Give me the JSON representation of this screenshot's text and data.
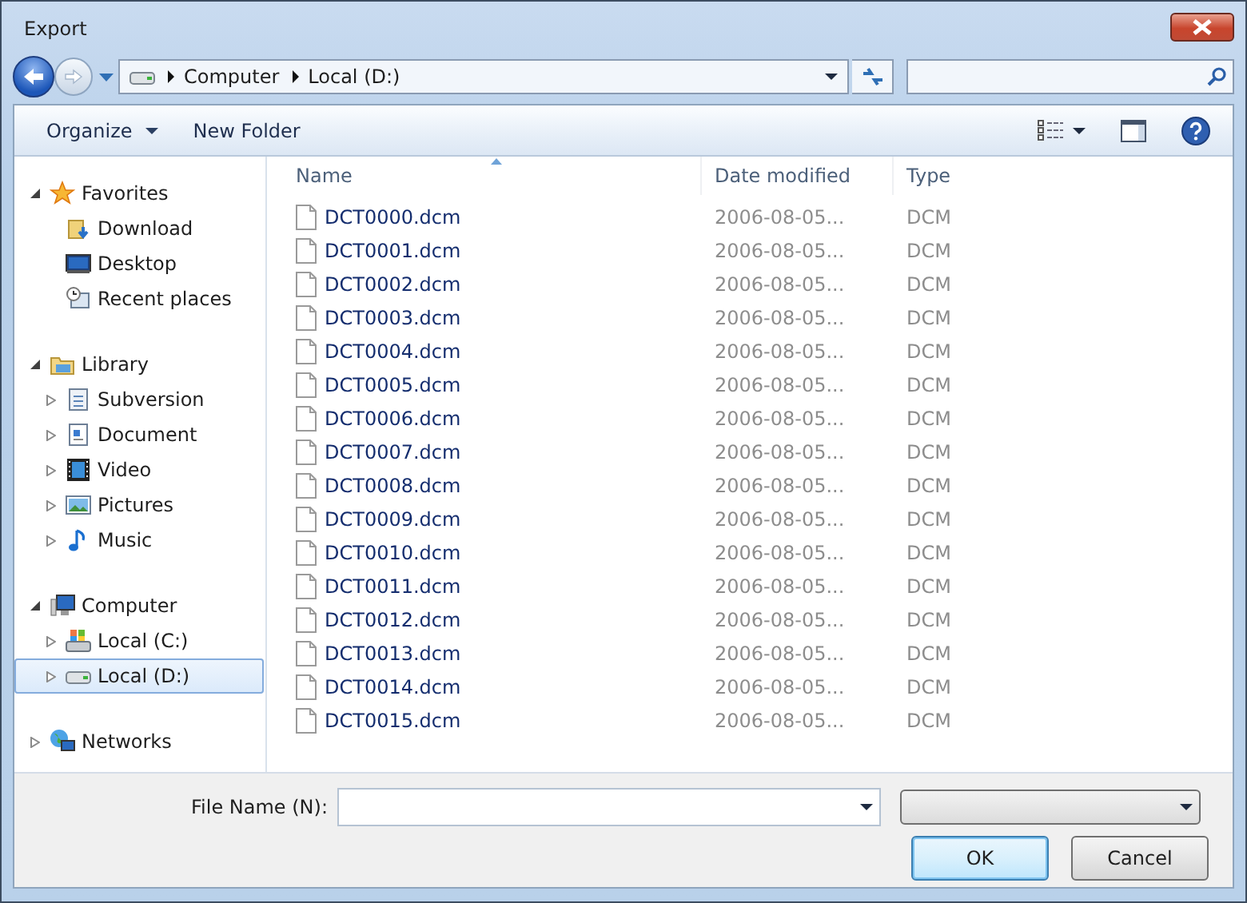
{
  "window": {
    "title": "Export"
  },
  "address": {
    "crumbs": [
      "Computer",
      "Local (D:)"
    ]
  },
  "toolbar": [
    {
      "label": "Organize",
      "dropdown": true
    },
    {
      "label": "New Folder",
      "dropdown": false
    }
  ],
  "sidebar": {
    "items": [
      {
        "label": "Favorites",
        "expanded": true,
        "selected": false,
        "children": [
          {
            "label": "Download",
            "selected": false
          },
          {
            "label": "Desktop",
            "selected": false
          },
          {
            "label": "Recent places",
            "selected": false
          }
        ]
      },
      {
        "label": "Library",
        "expanded": true,
        "selected": false,
        "children": [
          {
            "label": "Subversion",
            "expanded": false,
            "selected": false
          },
          {
            "label": "Document",
            "expanded": false,
            "selected": false
          },
          {
            "label": "Video",
            "expanded": false,
            "selected": false
          },
          {
            "label": "Pictures",
            "expanded": false,
            "selected": false
          },
          {
            "label": "Music",
            "expanded": false,
            "selected": false
          }
        ]
      },
      {
        "label": "Computer",
        "expanded": true,
        "selected": false,
        "children": [
          {
            "label": "Local (C:)",
            "expanded": false,
            "selected": false
          },
          {
            "label": "Local (D:)",
            "expanded": false,
            "selected": true
          }
        ]
      },
      {
        "label": "Networks",
        "expanded": false,
        "selected": false
      }
    ]
  },
  "table": {
    "columns": [
      {
        "label": "Name",
        "sorted": true
      },
      {
        "label": "Date modified",
        "sorted": false
      },
      {
        "label": "Type",
        "sorted": false
      }
    ],
    "rows": [
      {
        "name": "DCT0000.dcm",
        "date": "2006-08-05...",
        "type": "DCM"
      },
      {
        "name": "DCT0001.dcm",
        "date": "2006-08-05...",
        "type": "DCM"
      },
      {
        "name": "DCT0002.dcm",
        "date": "2006-08-05...",
        "type": "DCM"
      },
      {
        "name": "DCT0003.dcm",
        "date": "2006-08-05...",
        "type": "DCM"
      },
      {
        "name": "DCT0004.dcm",
        "date": "2006-08-05...",
        "type": "DCM"
      },
      {
        "name": "DCT0005.dcm",
        "date": "2006-08-05...",
        "type": "DCM"
      },
      {
        "name": "DCT0006.dcm",
        "date": "2006-08-05...",
        "type": "DCM"
      },
      {
        "name": "DCT0007.dcm",
        "date": "2006-08-05...",
        "type": "DCM"
      },
      {
        "name": "DCT0008.dcm",
        "date": "2006-08-05...",
        "type": "DCM"
      },
      {
        "name": "DCT0009.dcm",
        "date": "2006-08-05...",
        "type": "DCM"
      },
      {
        "name": "DCT0010.dcm",
        "date": "2006-08-05...",
        "type": "DCM"
      },
      {
        "name": "DCT0011.dcm",
        "date": "2006-08-05...",
        "type": "DCM"
      },
      {
        "name": "DCT0012.dcm",
        "date": "2006-08-05...",
        "type": "DCM"
      },
      {
        "name": "DCT0013.dcm",
        "date": "2006-08-05...",
        "type": "DCM"
      },
      {
        "name": "DCT0014.dcm",
        "date": "2006-08-05...",
        "type": "DCM"
      },
      {
        "name": "DCT0015.dcm",
        "date": "2006-08-05...",
        "type": "DCM"
      }
    ]
  },
  "file_name": {
    "label": "File Name (N):"
  },
  "buttons": [
    {
      "label": "OK",
      "default": true
    },
    {
      "label": "Cancel",
      "default": false
    }
  ]
}
